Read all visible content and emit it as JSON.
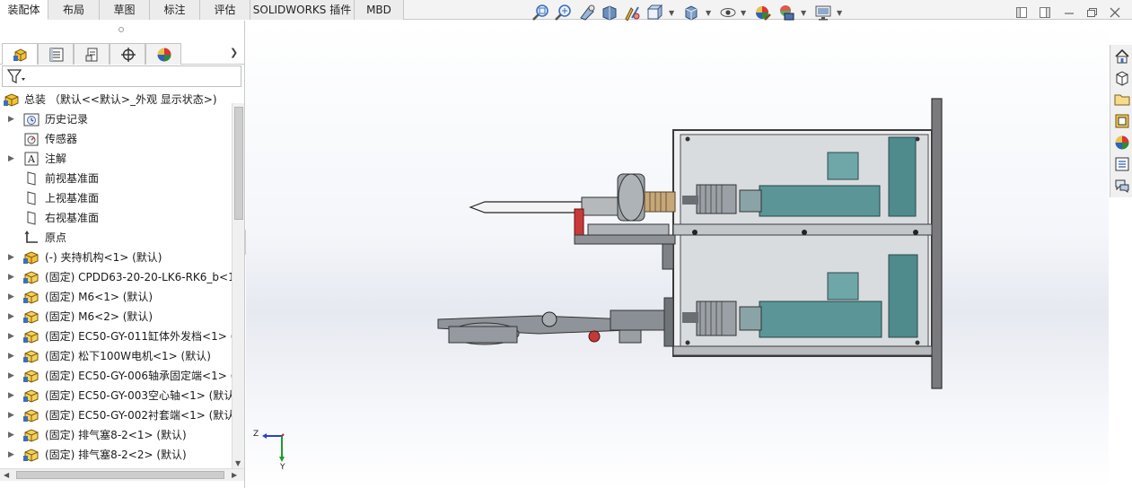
{
  "tabs": [
    {
      "label": "装配体",
      "active": true
    },
    {
      "label": "布局",
      "active": false
    },
    {
      "label": "草图",
      "active": false
    },
    {
      "label": "标注",
      "active": false
    },
    {
      "label": "评估",
      "active": false
    },
    {
      "label": "SOLIDWORKS 插件",
      "active": false
    },
    {
      "label": "MBD",
      "active": false
    }
  ],
  "hud_icons": [
    "zoom-to-fit-icon",
    "zoom-area-icon",
    "previous-view-icon",
    "section-view-icon",
    "dynamic-annotation-icon",
    "view-orientation-icon",
    "display-style-icon",
    "hide-show-icon",
    "edit-appearance-icon",
    "apply-scene-icon",
    "view-settings-icon"
  ],
  "window_controls": [
    "restore-down-icon",
    "tile-icon",
    "minimize-icon",
    "close-icon"
  ],
  "panel": {
    "tabs": [
      "featuremanager-icon",
      "propertymanager-icon",
      "configurationmanager-icon",
      "dimxpert-icon",
      "displaymanager-icon"
    ],
    "root_label": "总装 （默认<<默认>_外观 显示状态>)",
    "items": [
      {
        "label": "历史记录",
        "expandable": true,
        "icon": "history-folder-icon"
      },
      {
        "label": "传感器",
        "expandable": false,
        "icon": "sensor-icon"
      },
      {
        "label": "注解",
        "expandable": true,
        "icon": "annotation-icon"
      },
      {
        "label": "前视基准面",
        "expandable": false,
        "icon": "plane-icon"
      },
      {
        "label": "上视基准面",
        "expandable": false,
        "icon": "plane-icon"
      },
      {
        "label": "右视基准面",
        "expandable": false,
        "icon": "plane-icon"
      },
      {
        "label": "原点",
        "expandable": false,
        "icon": "origin-icon"
      },
      {
        "label": "(-) 夹持机构<1> (默认)",
        "expandable": true,
        "icon": "subassembly-icon"
      },
      {
        "label": "(固定) CPDD63-20-20-LK6-RK6_b<1",
        "expandable": true,
        "icon": "part-icon"
      },
      {
        "label": "(固定) M6<1> (默认)",
        "expandable": true,
        "icon": "part-icon"
      },
      {
        "label": "(固定) M6<2> (默认)",
        "expandable": true,
        "icon": "part-icon"
      },
      {
        "label": "(固定) EC50-GY-011缸体外发档<1> (",
        "expandable": true,
        "icon": "part-icon"
      },
      {
        "label": "(固定) 松下100W电机<1> (默认)",
        "expandable": true,
        "icon": "part-icon"
      },
      {
        "label": "(固定) EC50-GY-006轴承固定端<1> (",
        "expandable": true,
        "icon": "part-icon"
      },
      {
        "label": "(固定) EC50-GY-003空心轴<1> (默认)",
        "expandable": true,
        "icon": "part-icon"
      },
      {
        "label": "(固定) EC50-GY-002衬套端<1> (默认)",
        "expandable": true,
        "icon": "part-icon"
      },
      {
        "label": "(固定) 排气塞8-2<1> (默认)",
        "expandable": true,
        "icon": "part-icon"
      },
      {
        "label": "(固定) 排气塞8-2<2> (默认)",
        "expandable": true,
        "icon": "part-icon"
      }
    ]
  },
  "triad": {
    "z": "Z",
    "y": "Y"
  },
  "taskpane_icons": [
    "solidworks-resources-icon",
    "design-library-icon",
    "file-explorer-icon",
    "view-palette-icon",
    "appearances-icon",
    "custom-properties-icon",
    "forum-icon"
  ],
  "colors": {
    "accent": "#2e6fd0",
    "assembly_yellow": "#f2c23a",
    "model_teal": "#4e8a8c",
    "model_gray": "#8a8a8a",
    "frame_dark": "#5c5c5e"
  }
}
